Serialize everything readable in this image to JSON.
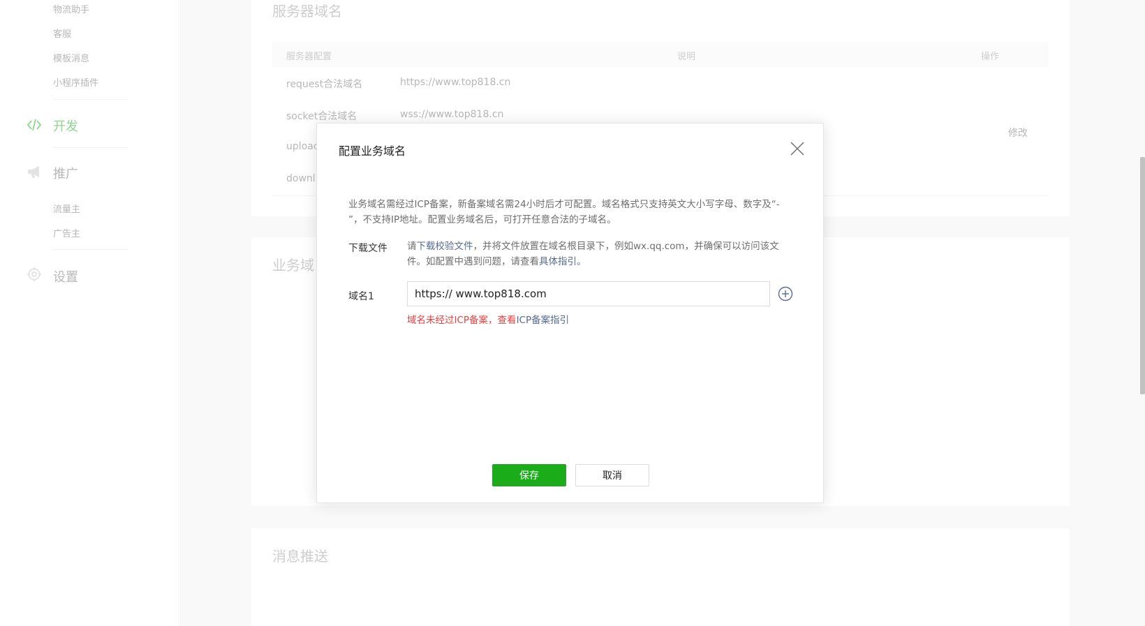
{
  "sidebar": {
    "sub_items_top": [
      "物流助手",
      "客服",
      "模板消息",
      "小程序插件"
    ],
    "nav": {
      "develop": "开发",
      "promote": "推广",
      "settings": "设置"
    },
    "promote_items": [
      "流量主",
      "广告主"
    ]
  },
  "server_card": {
    "title": "服务器域名",
    "headers": {
      "config": "服务器配置",
      "desc": "说明",
      "action": "操作"
    },
    "rows": [
      {
        "key": "request合法域名",
        "value": "https://www.top818.cn"
      },
      {
        "key": "socket合法域名",
        "value": "wss://www.top818.cn"
      },
      {
        "key": "uploac",
        "value": ""
      },
      {
        "key": "downl",
        "value": ""
      }
    ],
    "edit": "修改"
  },
  "business_card": {
    "title": "业务域"
  },
  "message_card": {
    "title": "消息推送"
  },
  "dialog": {
    "title": "配置业务域名",
    "description": "业务域名需经过ICP备案，新备案域名需24小时后才可配置。域名格式只支持英文大小写字母、数字及“- ”，不支持IP地址。配置业务域名后，可打开任意合法的子域名。",
    "download_label": "下载文件",
    "download_text": {
      "prefix": "请",
      "link": "下载校验文件",
      "middle": "，并将文件放置在域名根目录下，例如wx.qq.com，并确保可以访问该文件。如配置中遇到问题，请查看",
      "guide": "具体指引。"
    },
    "domain_label": "域名1",
    "domain_value": "https:// www.top818.com",
    "error": {
      "text": "域名未经过ICP备案，查看",
      "link": "ICP备案指引"
    },
    "save": "保存",
    "cancel": "取消"
  },
  "colors": {
    "accent": "#1aad19",
    "link": "#576b95",
    "error": "#e64340"
  }
}
